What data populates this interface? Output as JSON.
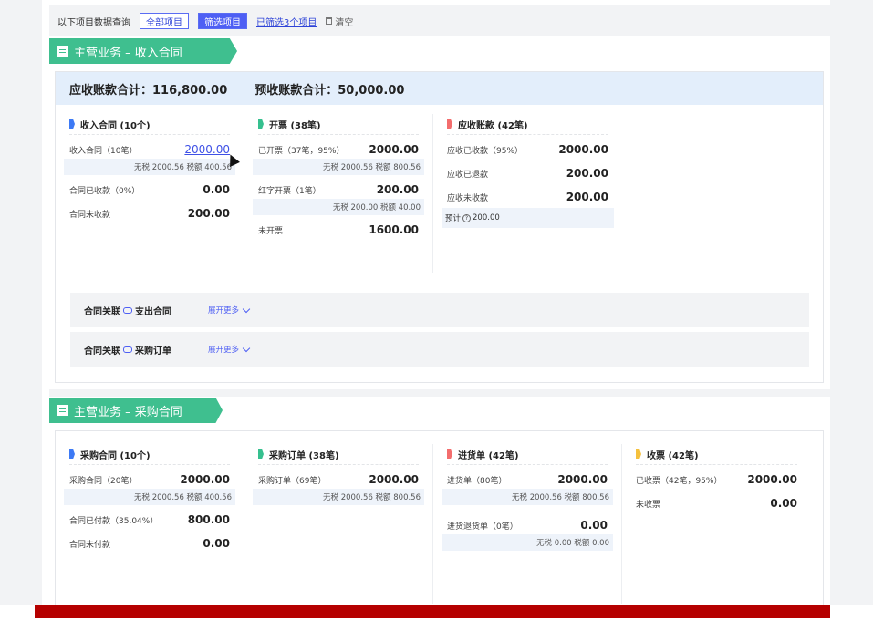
{
  "filter_bar": {
    "title": "以下项目数据查询",
    "btn_all": "全部项目",
    "btn_filter": "筛选项目",
    "filtered_link": "已筛选3个项目",
    "clear": "清空"
  },
  "revenue": {
    "banner": "主营业务 – 收入合同",
    "summary": {
      "receivable": "应收账款合计：116,800.00",
      "advance": "预收账款合计：50,000.00"
    },
    "cols": [
      {
        "head": "收入合同 (10个)",
        "color": "#3d7af5",
        "rows": [
          {
            "label": "收入合同（10笔）",
            "value": "2000.00",
            "tax": "无税 2000.56 税额 400.56"
          },
          {
            "label": "合同已收款（0%）",
            "value": "0.00"
          },
          {
            "label": "合同未收款",
            "value": "200.00"
          }
        ]
      },
      {
        "head": "开票 (38笔)",
        "color": "#36c08f",
        "rows": [
          {
            "label": "已开票（37笔，95%）",
            "value": "2000.00",
            "tax": "无税 2000.56 税额 800.56"
          },
          {
            "label": "红字开票（1笔）",
            "value": "200.00",
            "tax": "无税 200.00 税额 40.00"
          },
          {
            "label": "未开票",
            "value": "1600.00"
          }
        ]
      },
      {
        "head": "应收账款 (42笔)",
        "color": "#f36d6d",
        "rows": [
          {
            "label": "应收已收款（95%）",
            "value": "2000.00"
          },
          {
            "label": "应收已退款",
            "value": "200.00"
          },
          {
            "label": "应收未收款",
            "value": "200.00"
          }
        ],
        "forecast_label": "预计",
        "forecast_value": "200.00"
      }
    ],
    "relations": [
      {
        "label": "合同关联",
        "target": "支出合同",
        "more": "展开更多"
      },
      {
        "label": "合同关联",
        "target": "采购订单",
        "more": "展开更多"
      }
    ]
  },
  "purchase": {
    "banner": "主营业务 – 采购合同",
    "cols": [
      {
        "head": "采购合同 (10个)",
        "color": "#3d7af5",
        "rows": [
          {
            "label": "采购合同（20笔）",
            "value": "2000.00",
            "tax": "无税 2000.56 税额 400.56"
          },
          {
            "label": "合同已付款（35.04%）",
            "value": "800.00"
          },
          {
            "label": "合同未付款",
            "value": "0.00"
          }
        ]
      },
      {
        "head": "采购订单 (38笔)",
        "color": "#36c08f",
        "rows": [
          {
            "label": "采购订单（69笔）",
            "value": "2000.00",
            "tax": "无税 2000.56 税额 800.56"
          }
        ]
      },
      {
        "head": "进货单 (42笔)",
        "color": "#f36d6d",
        "rows": [
          {
            "label": "进货单（80笔）",
            "value": "2000.00",
            "tax": "无税 2000.56 税额 800.56"
          },
          {
            "label": "进货退货单（0笔）",
            "value": "0.00",
            "tax": "无税 0.00 税额 0.00"
          }
        ]
      },
      {
        "head": "收票 (42笔)",
        "color": "#f5c13d",
        "rows": [
          {
            "label": "已收票（42笔，95%）",
            "value": "2000.00"
          },
          {
            "label": "未收票",
            "value": "0.00"
          }
        ]
      }
    ]
  }
}
